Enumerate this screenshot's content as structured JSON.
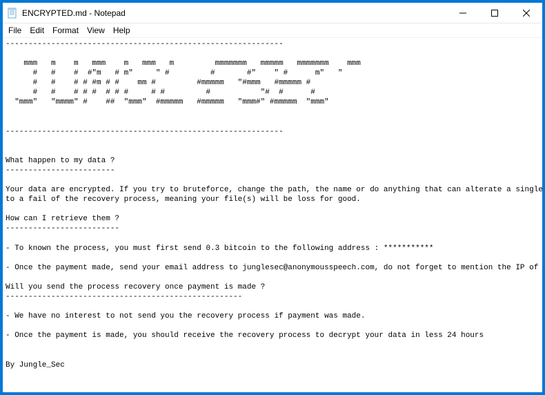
{
  "window": {
    "title": "ENCRYPTED.md - Notepad"
  },
  "menu": {
    "file": "File",
    "edit": "Edit",
    "format": "Format",
    "view": "View",
    "help": "Help"
  },
  "document": {
    "text": "-------------------------------------------------------------\n\n    mmm   m    m   mmm    m   mmm   m         mmmmmmm   mmmmm   mmmmmmm    mmm\n      #   #    #  #\"m   # m\"     \" #         #       #\"    \" #      m\"   \"\n      #   #    # # #m # #    mm #         #mmmmm   \"#mmm   #mmmmm #\n      #   #    # # #  # # #     # #         #           \"#  #      #\n  \"mmm\"   \"mmmm\" #    ##  \"mmm\"  #mmmmm   #mmmmm   \"mmm#\" #mmmmm  \"mmm\"\n\n\n-------------------------------------------------------------\n\n\nWhat happen to my data ?\n------------------------\n\nYour data are encrypted. If you try to bruteforce, change the path, the name or do anything that can alterate a single byte of a file(s) will result\nto a fail of the recovery process, meaning your file(s) will be loss for good.\n\nHow can I retrieve them ?\n-------------------------\n\n- To known the process, you must first send 0.3 bitcoin to the following address : ***********\n\n- Once the payment made, send your email address to junglesec@anonymousspeech.com, do not forget to mention the IP of server/computer\n\nWill you send the process recovery once payment is made ?\n----------------------------------------------------\n\n- We have no interest to not send you the recovery process if payment was made.\n\n- Once the payment is made, you should receive the recovery process to decrypt your data in less 24 hours\n\n\nBy Jungle_Sec"
  }
}
